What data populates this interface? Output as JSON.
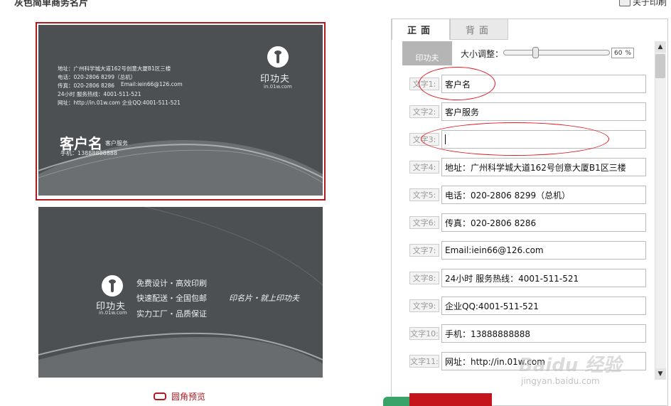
{
  "page": {
    "title": "灰色简单商务名片",
    "about_label": "关于印刷"
  },
  "front_card": {
    "address": "地址：广州科学城大道162号创意大厦B1区三楼",
    "phone": "电话：020-2806 8299（总机）",
    "fax": "传真：020-2806 8286",
    "email": "Email:iein66@126.com",
    "hotline": "24小时 服务热线：4001-511-521",
    "website_qq": "网址：http://in.01w.com  企业QQ:4001-511-521",
    "customer_name": "客户名",
    "customer_service": "客户服务",
    "mobile": "手机：13888888888",
    "brand": "印功夫",
    "domain": "in.01w.com"
  },
  "back_card": {
    "brand": "印功夫",
    "domain": "in.01w.com",
    "slogans": [
      "免费设计・高效印刷",
      "快速配送・全国包邮",
      "实力工厂・品质保证"
    ],
    "signature": "印名片・就上印功夫"
  },
  "round_preview_label": "圆角预览",
  "editor": {
    "tabs": {
      "front": "正面",
      "back": "背面"
    },
    "thumb_label": "印功夫",
    "size_label": "大小调整：",
    "size_value": "60",
    "size_unit": "%",
    "size_fraction": 0.3,
    "rows": [
      {
        "label": "文字1:",
        "value": "客户名"
      },
      {
        "label": "文字2:",
        "value": "客户服务"
      },
      {
        "label": "文字3:",
        "value": ""
      },
      {
        "label": "文字4:",
        "value": "地址：广州科学城大道162号创意大厦B1区三楼"
      },
      {
        "label": "文字5:",
        "value": "电话：020-2806 8299（总机）"
      },
      {
        "label": "文字6:",
        "value": "传真：020-2806 8286"
      },
      {
        "label": "文字7:",
        "value": "Email:iein66@126.com"
      },
      {
        "label": "文字8:",
        "value": "24小时  服务热线：4001-511-521"
      },
      {
        "label": "文字9:",
        "value": "企业QQ:4001-511-521"
      },
      {
        "label": "文字10:",
        "value": "手机：13888888888"
      },
      {
        "label": "文字11:",
        "value": "网址：http://in.01w.com"
      }
    ]
  },
  "watermark": {
    "text": "Baidu 经验",
    "url": "jingyan.baidu.com"
  },
  "colors": {
    "card_bg": "#4d5053",
    "accent_red": "#b0191e",
    "annotation_red": "#e0191e"
  }
}
